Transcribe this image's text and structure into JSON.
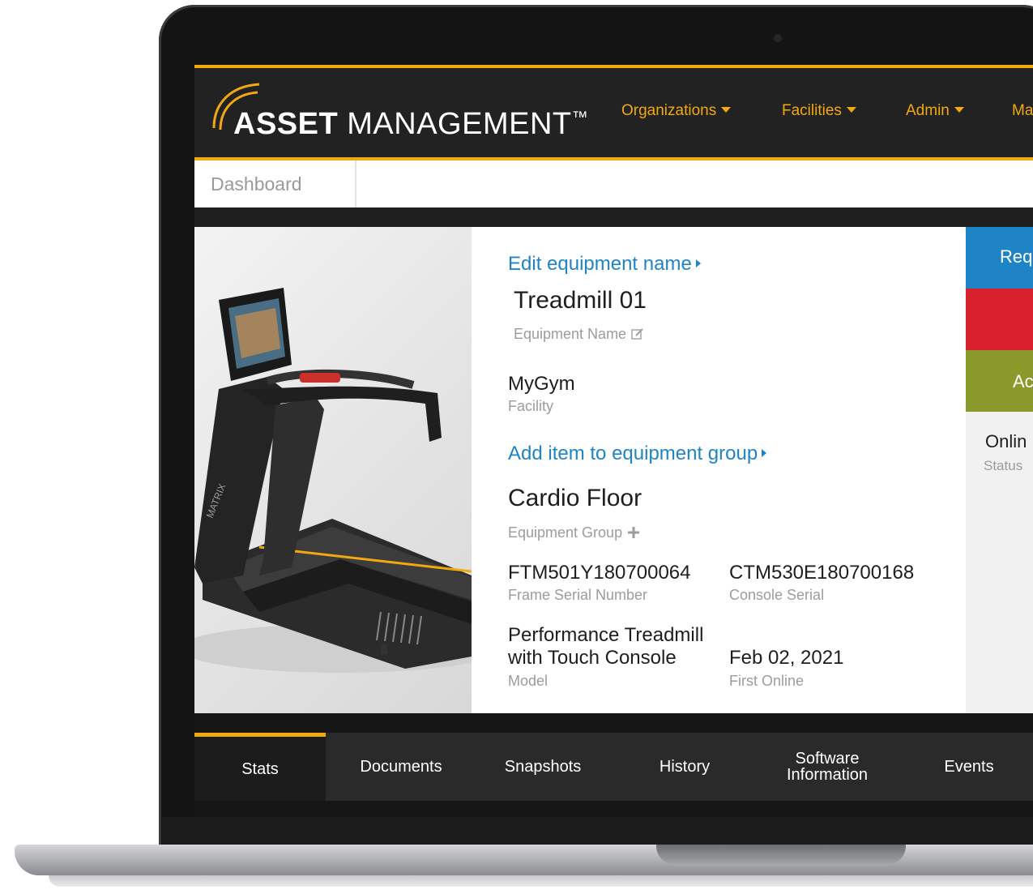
{
  "brand": {
    "name_bold": "ASSET",
    "name_rest": "MANAGEMENT",
    "trademark": "™"
  },
  "nav": [
    {
      "label": "Organizations"
    },
    {
      "label": "Facilities"
    },
    {
      "label": "Admin"
    },
    {
      "label": "Ma"
    }
  ],
  "breadcrumb": {
    "label": "Dashboard"
  },
  "equipment": {
    "edit_name_link": "Edit equipment name",
    "name": "Treadmill 01",
    "name_label": "Equipment Name",
    "facility": "MyGym",
    "facility_label": "Facility",
    "add_group_link": "Add item to equipment group",
    "group": "Cardio Floor",
    "group_label": "Equipment Group",
    "frame_serial": "FTM501Y180700064",
    "frame_serial_label": "Frame Serial Number",
    "console_serial": "CTM530E180700168",
    "console_serial_label": "Console Serial",
    "model_line1": "Performance Treadmill",
    "model_line2": "with Touch Console",
    "model_label": "Model",
    "first_online": "Feb 02, 2021",
    "first_online_label": "First Online",
    "brand_on_frame": "MATRIX"
  },
  "side_panel": {
    "request_button": "Req",
    "add_button": "Ac",
    "status_value": "Onlin",
    "status_label": "Status",
    "colors": {
      "blue": "#1f84c6",
      "red": "#d9202f",
      "olive": "#8a9a2a"
    }
  },
  "tabs": [
    {
      "label": "Stats",
      "active": true
    },
    {
      "label": "Documents"
    },
    {
      "label": "Snapshots"
    },
    {
      "label": "History"
    },
    {
      "label_line1": "Software",
      "label_line2": "Information"
    },
    {
      "label": "Events"
    }
  ],
  "colors": {
    "accent": "#f2a80f",
    "link": "#1f84c6",
    "header_bg": "#222222"
  }
}
